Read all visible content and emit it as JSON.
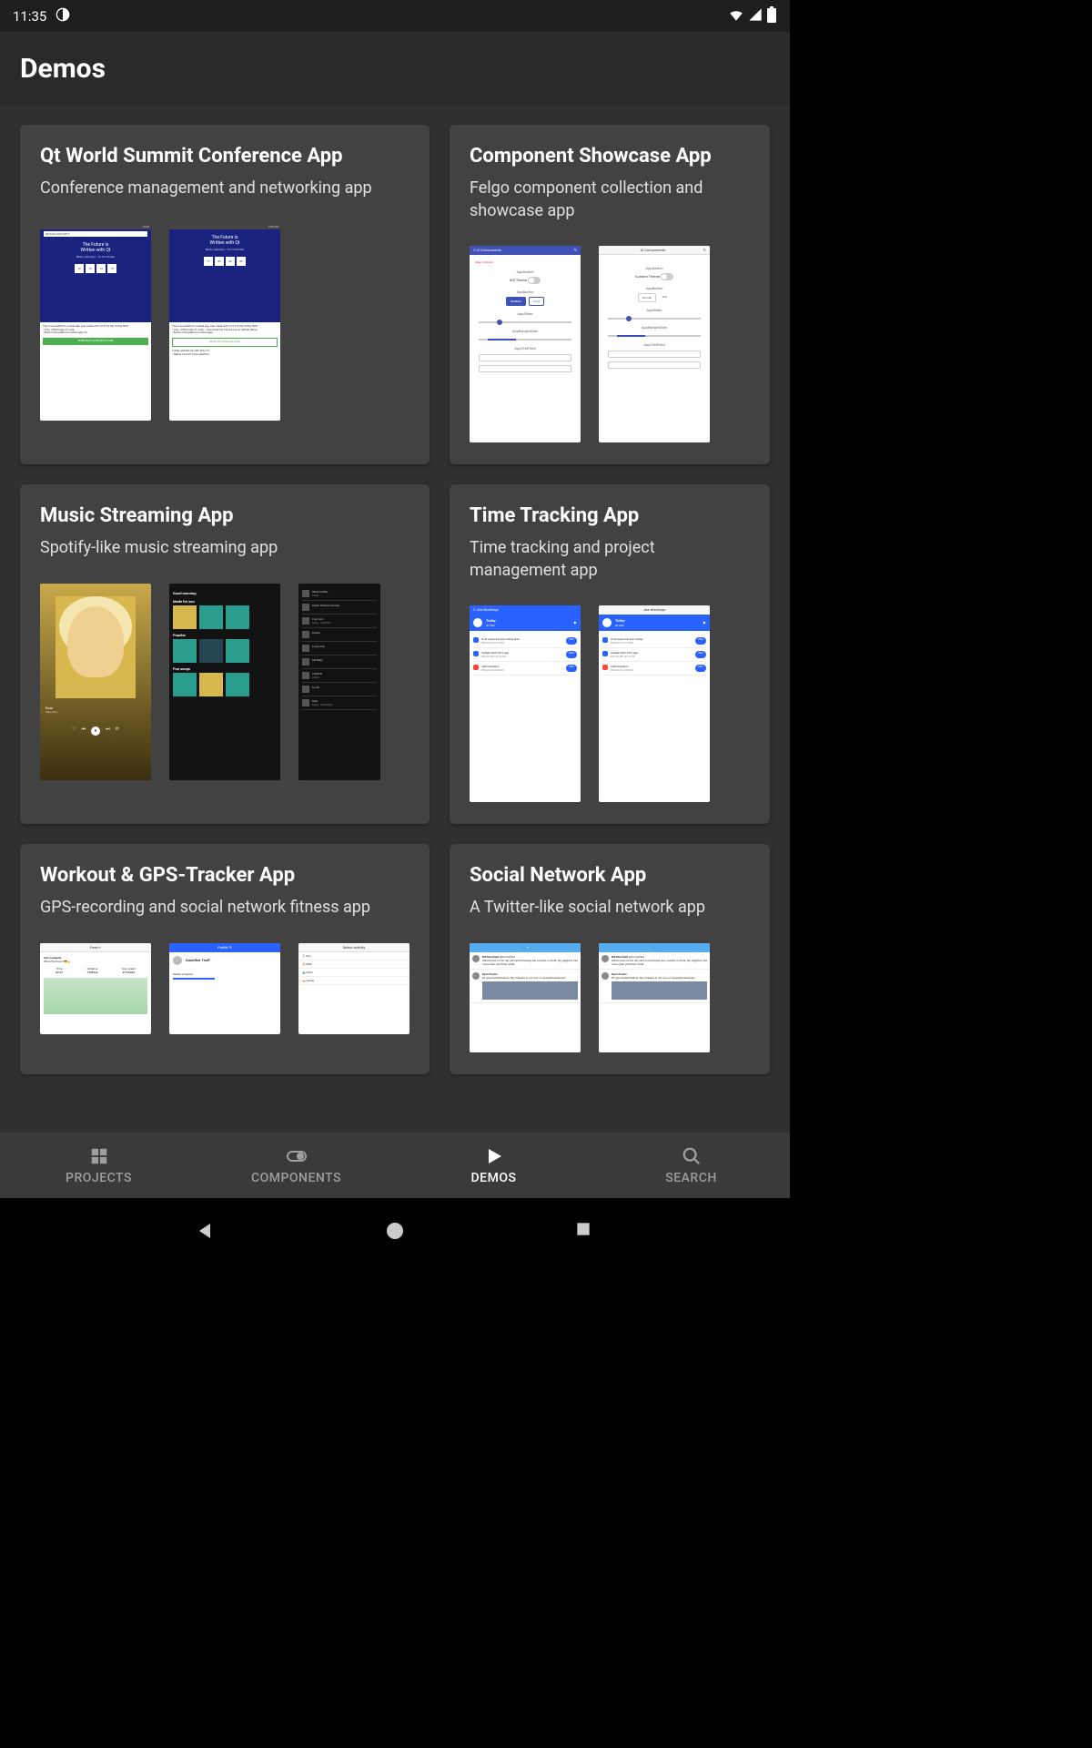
{
  "status": {
    "time": "11:35"
  },
  "header": {
    "title": "Demos"
  },
  "cards": [
    {
      "title": "Qt World Summit Conference App",
      "desc": "Conference management and networking app"
    },
    {
      "title": "Component Showcase App",
      "desc": "Felgo component collection and showcase app"
    },
    {
      "title": "Music Streaming App",
      "desc": "Spotify-like music streaming app"
    },
    {
      "title": "Time Tracking App",
      "desc": "Time tracking and project management app"
    },
    {
      "title": "Workout & GPS-Tracker App",
      "desc": "GPS-recording and social network fitness app"
    },
    {
      "title": "Social Network App",
      "desc": "A Twitter-like social network app"
    }
  ],
  "nav": {
    "projects": "PROJECTS",
    "components": "COMPONENTS",
    "demos": "DEMOS",
    "search": "SEARCH"
  }
}
